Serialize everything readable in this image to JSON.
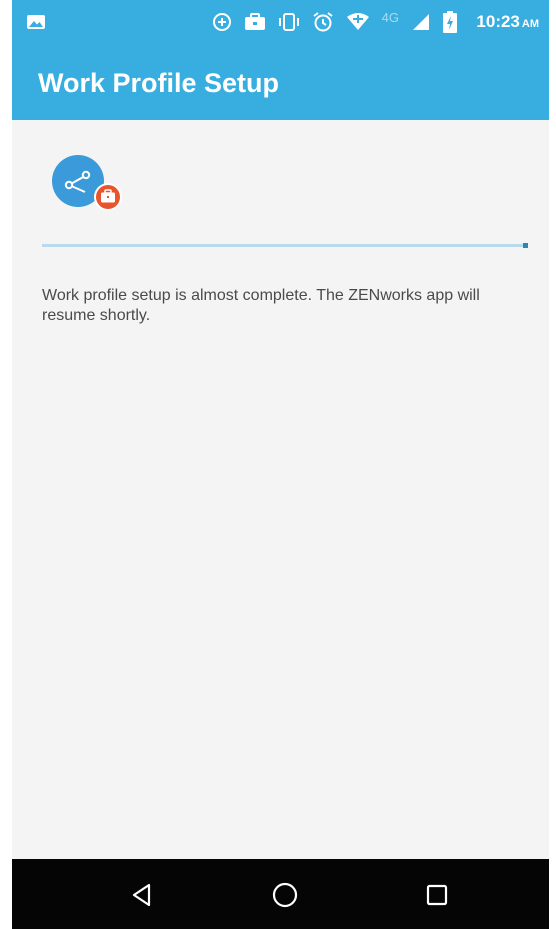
{
  "status_bar": {
    "time": "10:23",
    "ampm": "AM",
    "network_label": "4G",
    "icons": [
      "gallery-icon",
      "data-saver-icon",
      "briefcase-icon",
      "vibrate-icon",
      "alarm-icon",
      "wifi-icon",
      "cell-signal-icon",
      "battery-charging-icon"
    ]
  },
  "app_bar": {
    "title": "Work Profile Setup"
  },
  "setup": {
    "icon": "share-icon",
    "badge_icon": "work-badge-icon",
    "progress_percent": 99,
    "message": "Work profile setup is almost complete. The ZENworks app will resume shortly."
  },
  "nav_bar": {
    "buttons": [
      "back-icon",
      "home-icon",
      "recents-icon"
    ]
  },
  "colors": {
    "accent": "#38aee0",
    "icon_blue": "#3b9ad9",
    "badge_red": "#e9542d",
    "progress_track": "#b8dbec",
    "progress_end": "#2f86b6",
    "background": "#f4f4f4",
    "nav_background": "#050505"
  }
}
